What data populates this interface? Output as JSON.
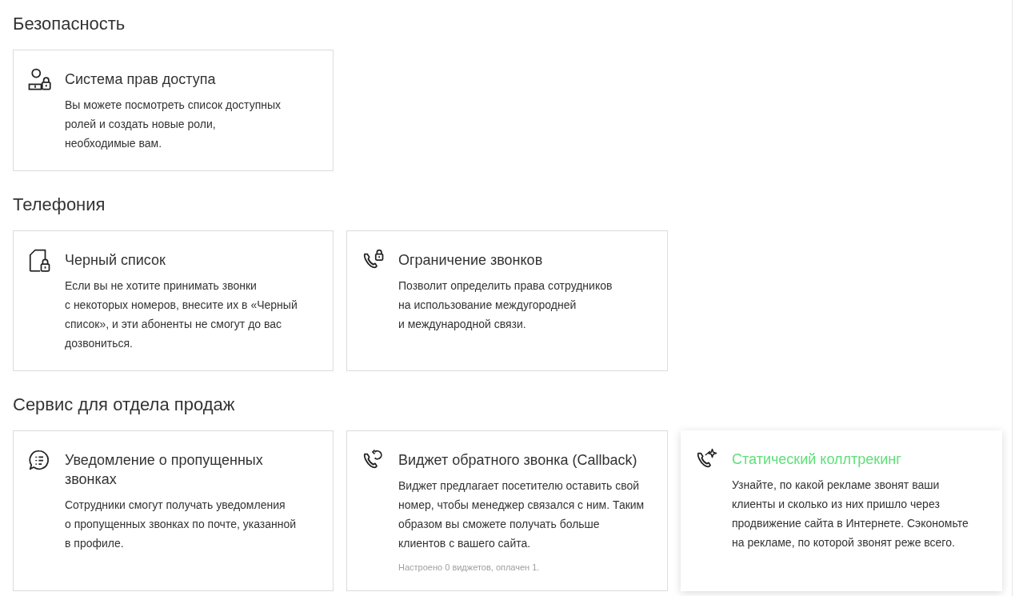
{
  "sections": [
    {
      "title": "Безопасность",
      "cards": [
        {
          "title": "Система прав доступа",
          "description": "Вы можете посмотреть список доступных\nролей и создать новые роли,\nнеобходимые вам.",
          "hovered": false
        }
      ]
    },
    {
      "title": "Телефония",
      "cards": [
        {
          "title": "Черный список",
          "description": "Если вы не хотите принимать звонки\nс некоторых номеров, внесите их в «Черный\nсписок», и эти абоненты не смогут до вас\nдозвониться.",
          "hovered": false
        },
        {
          "title": "Ограничение звонков",
          "description": "Позволит определить права сотрудников\nна использование междугородней\nи международной связи.",
          "hovered": false
        }
      ]
    },
    {
      "title": "Сервис для отдела продаж",
      "cards": [
        {
          "title": "Уведомление о пропущенных\nзвонках",
          "description": "Сотрудники смогут получать уведомления\nо пропущенных звонках по почте, указанной\nв профиле.",
          "hovered": false
        },
        {
          "title": "Виджет обратного звонка (Callback)",
          "description": "Виджет предлагает посетителю оставить свой\nномер, чтобы менеджер связался с ним. Таким\nобразом вы сможете получать больше\nклиентов с вашего сайта.",
          "note": "Настроено 0 виджетов, оплачен 1.",
          "hovered": false
        },
        {
          "title": "Статический коллтрекинг",
          "description": "Узнайте, по какой рекламе звонят ваши\nклиенты и сколько из них пришло через\nпродвижение сайта в Интернете. Сэкономьте\nна рекламе, по которой звонят реже всего.",
          "hovered": true
        }
      ]
    }
  ]
}
